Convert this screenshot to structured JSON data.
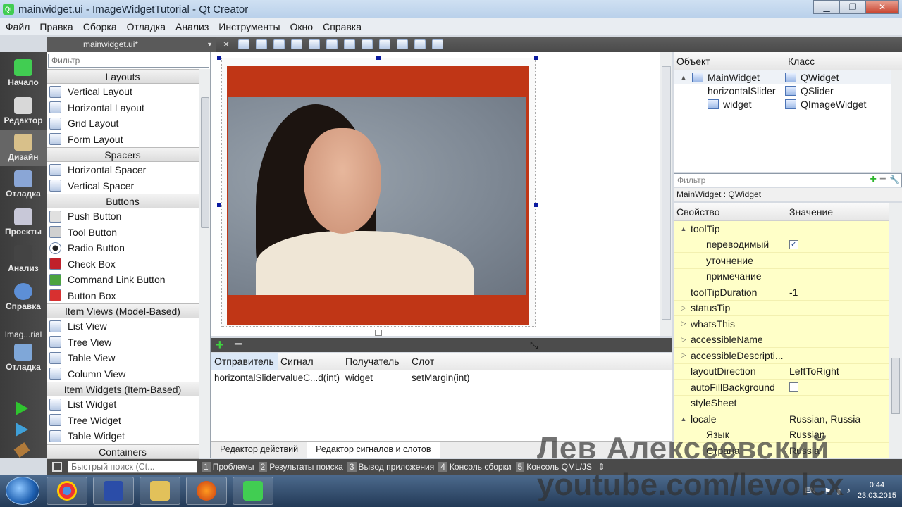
{
  "window": {
    "title": "mainwidget.ui - ImageWidgetTutorial - Qt Creator",
    "app_icon": "Qt"
  },
  "menu": [
    "Файл",
    "Правка",
    "Сборка",
    "Отладка",
    "Анализ",
    "Инструменты",
    "Окно",
    "Справка"
  ],
  "modes": [
    {
      "label": "Начало",
      "icon": "qt-logo-icon"
    },
    {
      "label": "Редактор",
      "icon": "editor-icon"
    },
    {
      "label": "Дизайн",
      "icon": "design-icon"
    },
    {
      "label": "Отладка",
      "icon": "debug-icon"
    },
    {
      "label": "Проекты",
      "icon": "projects-icon"
    },
    {
      "label": "Анализ",
      "icon": "analyze-icon"
    },
    {
      "label": "Справка",
      "icon": "help-icon"
    }
  ],
  "kit": {
    "label": "Imag...rial",
    "debug_label": "Отладка"
  },
  "document_tab": "mainwidget.ui*",
  "widget_box": {
    "filter_placeholder": "Фильтр",
    "categories": [
      {
        "name": "Layouts",
        "items": [
          "Vertical Layout",
          "Horizontal Layout",
          "Grid Layout",
          "Form Layout"
        ]
      },
      {
        "name": "Spacers",
        "items": [
          "Horizontal Spacer",
          "Vertical Spacer"
        ]
      },
      {
        "name": "Buttons",
        "items": [
          "Push Button",
          "Tool Button",
          "Radio Button",
          "Check Box",
          "Command Link Button",
          "Button Box"
        ]
      },
      {
        "name": "Item Views (Model-Based)",
        "items": [
          "List View",
          "Tree View",
          "Table View",
          "Column View"
        ]
      },
      {
        "name": "Item Widgets (Item-Based)",
        "items": [
          "List Widget",
          "Tree Widget",
          "Table Widget"
        ]
      },
      {
        "name": "Containers",
        "items": []
      }
    ]
  },
  "signal_editor": {
    "headers": [
      "Отправитель",
      "Сигнал",
      "Получатель",
      "Слот"
    ],
    "rows": [
      [
        "horizontalSlider",
        "valueC...d(int)",
        "widget",
        "setMargin(int)"
      ]
    ],
    "tabs": [
      "Редактор действий",
      "Редактор сигналов и слотов"
    ]
  },
  "object_inspector": {
    "headers": [
      "Объект",
      "Класс"
    ],
    "rows": [
      {
        "object": "MainWidget",
        "class": "QWidget"
      },
      {
        "object": "horizontalSlider",
        "class": "QSlider"
      },
      {
        "object": "widget",
        "class": "QImageWidget"
      }
    ]
  },
  "property_editor": {
    "filter_placeholder": "Фильтр",
    "object_class": "MainWidget : QWidget",
    "headers": [
      "Свойство",
      "Значение"
    ],
    "rows": [
      {
        "name": "toolTip",
        "value": "",
        "level": 0,
        "expander": "open"
      },
      {
        "name": "переводимый",
        "value": "",
        "level": 1,
        "checkbox": true
      },
      {
        "name": "уточнение",
        "value": "",
        "level": 1
      },
      {
        "name": "примечание",
        "value": "",
        "level": 1
      },
      {
        "name": "toolTipDuration",
        "value": "-1",
        "level": 0
      },
      {
        "name": "statusTip",
        "value": "",
        "level": 0,
        "expander": "closed"
      },
      {
        "name": "whatsThis",
        "value": "",
        "level": 0,
        "expander": "closed"
      },
      {
        "name": "accessibleName",
        "value": "",
        "level": 0,
        "expander": "closed"
      },
      {
        "name": "accessibleDescripti...",
        "value": "",
        "level": 0,
        "expander": "closed"
      },
      {
        "name": "layoutDirection",
        "value": "LeftToRight",
        "level": 0
      },
      {
        "name": "autoFillBackground",
        "value": "",
        "level": 0,
        "checkbox": false
      },
      {
        "name": "styleSheet",
        "value": "",
        "level": 0
      },
      {
        "name": "locale",
        "value": "Russian, Russia",
        "level": 0,
        "expander": "open"
      },
      {
        "name": "Язык",
        "value": "Russian",
        "level": 1
      },
      {
        "name": "Страна",
        "value": "Russia",
        "level": 1
      }
    ]
  },
  "output_bar": {
    "search_placeholder": "Быстрый поиск (Ct...",
    "tabs": [
      {
        "n": "1",
        "label": "Проблемы"
      },
      {
        "n": "2",
        "label": "Результаты поиска"
      },
      {
        "n": "3",
        "label": "Вывод приложения"
      },
      {
        "n": "4",
        "label": "Консоль сборки"
      },
      {
        "n": "5",
        "label": "Консоль QML/JS"
      }
    ]
  },
  "taskbar": {
    "apps": [
      "chrome-icon",
      "save-icon",
      "folder-icon",
      "firefox-icon",
      "qt-creator-icon"
    ],
    "lang": "EN",
    "time": "0:44",
    "date": "23.03.2015"
  },
  "watermark": {
    "name": "Лев Алексеевский",
    "url": "youtube.com/levolex"
  }
}
